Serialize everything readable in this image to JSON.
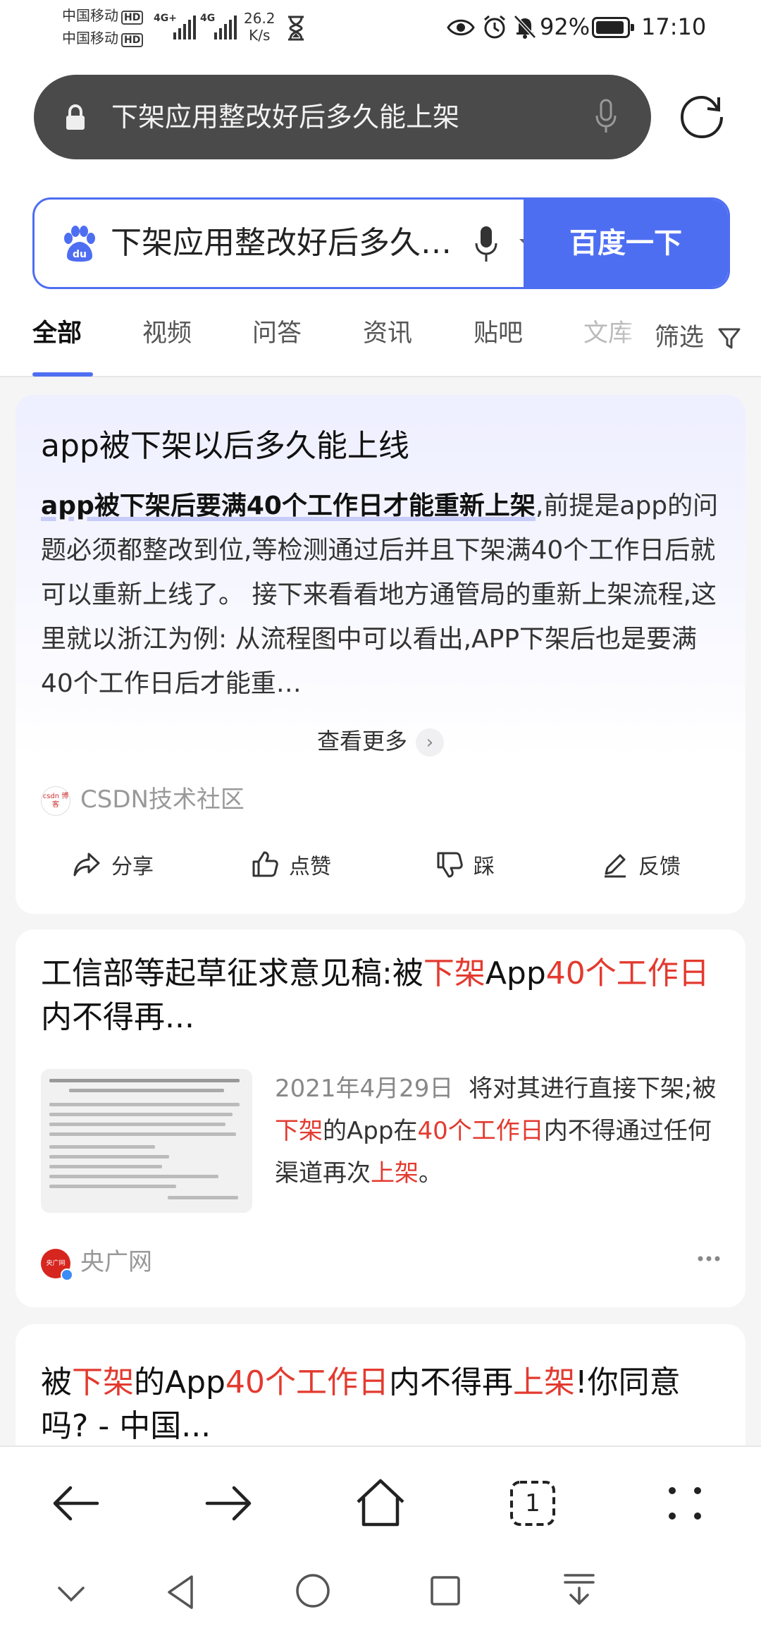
{
  "status_bar": {
    "carrier1": "中国移动",
    "carrier2": "中国移动",
    "hd": "HD",
    "net1": "4G+",
    "net2": "4G",
    "speed_value": "26.2",
    "speed_unit": "K/s",
    "battery": "92%",
    "battery_level": 0.92,
    "time": "17:10"
  },
  "url_bar": {
    "text": "下架应用整改好后多久能上架"
  },
  "search": {
    "query": "下架应用整改好后多久能上架",
    "button": "百度一下"
  },
  "tabs": {
    "items": [
      "全部",
      "视频",
      "问答",
      "资讯",
      "贴吧",
      "文库"
    ],
    "active": "全部",
    "filter": "筛选"
  },
  "card1": {
    "title": "app被下架以后多久能上线",
    "highlight": "app被下架后要满40个工作日才能重新上架",
    "body": ",前提是app的问题必须都整改到位,等检测通过后并且下架满40个工作日后就可以重新上线了。 接下来看看地方通管局的重新上架流程,这里就以浙江为例: 从流程图中可以看出,APP下架后也是要满40个工作日后才能重…",
    "more": "查看更多",
    "source": "CSDN技术社区",
    "source_icon_text": "csdn 博客",
    "actions": {
      "share": "分享",
      "like": "点赞",
      "dislike": "踩",
      "feedback": "反馈"
    }
  },
  "card2": {
    "title_parts": [
      "工信部等起草征求意见稿:被",
      "下架",
      "App",
      "40个工作日",
      "内不得再..."
    ],
    "date": "2021年4月29日",
    "body_parts": [
      "将对其进行直接下架;被",
      "下架",
      "的App在",
      "40个工作日",
      "内不得通过任何渠道再次",
      "上架",
      "。"
    ],
    "source": "央广网",
    "source_icon_text": "央广网",
    "more_icon": "more-dots-icon"
  },
  "card3": {
    "title_parts": [
      "被",
      "下架",
      "的App",
      "40个工作日",
      "内不得再",
      "上架",
      "!你同意吗? - 中国..."
    ]
  },
  "bottom_nav": {
    "tab_count": "1"
  },
  "colors": {
    "accent": "#4e6ef2",
    "highlight_red": "#e33a2f",
    "url_bar_bg": "#4a4a4a"
  }
}
